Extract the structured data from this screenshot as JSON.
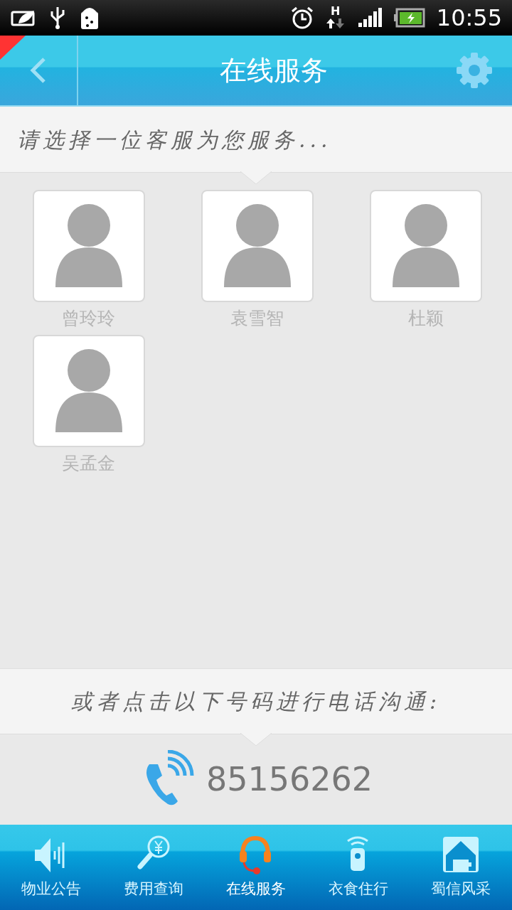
{
  "status_bar": {
    "network_type": "H",
    "time": "10:55"
  },
  "header": {
    "title": "在线服务"
  },
  "prompt": "请选择一位客服为您服务...",
  "agents": [
    {
      "name": "曾玲玲"
    },
    {
      "name": "袁雪智"
    },
    {
      "name": "杜颖"
    },
    {
      "name": "吴孟金"
    }
  ],
  "phone_prompt": "或者点击以下号码进行电话沟通:",
  "phone": "85156262",
  "tabs": [
    {
      "label": "物业公告",
      "kind": "speaker",
      "selected": false
    },
    {
      "label": "费用查询",
      "kind": "search",
      "selected": false
    },
    {
      "label": "在线服务",
      "kind": "headset",
      "selected": true
    },
    {
      "label": "衣食住行",
      "kind": "remote",
      "selected": false
    },
    {
      "label": "蜀信风采",
      "kind": "house",
      "selected": false
    }
  ]
}
